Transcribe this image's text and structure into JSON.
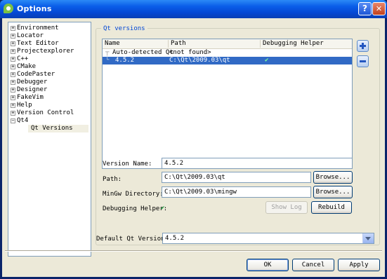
{
  "window": {
    "title": "Options",
    "help_label": "?",
    "close_label": "✕"
  },
  "tree": {
    "items": [
      {
        "label": "Environment",
        "expander": "+"
      },
      {
        "label": "Locator",
        "expander": "+"
      },
      {
        "label": "Text Editor",
        "expander": "+"
      },
      {
        "label": "Projectexplorer",
        "expander": "+"
      },
      {
        "label": "C++",
        "expander": "+"
      },
      {
        "label": "CMake",
        "expander": "+"
      },
      {
        "label": "CodePaster",
        "expander": "+"
      },
      {
        "label": "Debugger",
        "expander": "+"
      },
      {
        "label": "Designer",
        "expander": "+"
      },
      {
        "label": "FakeVim",
        "expander": "+"
      },
      {
        "label": "Help",
        "expander": "+"
      },
      {
        "label": "Version Control",
        "expander": "+"
      },
      {
        "label": "Qt4",
        "expander": "−"
      }
    ],
    "selected_child": "Qt Versions"
  },
  "group": {
    "title": "Qt versions"
  },
  "versions_table": {
    "columns": [
      "Name",
      "Path",
      "Debugging Helper"
    ],
    "rows": [
      {
        "name": "Auto-detected Qt",
        "path": "<not found>",
        "helper": ""
      },
      {
        "name": "4.5.2",
        "path": "C:\\Qt\\2009.03\\qt",
        "helper": "✔"
      }
    ]
  },
  "details": {
    "version_name_label": "Version Name:",
    "version_name_value": "4.5.2",
    "path_label": "Path:",
    "path_value": "C:\\Qt\\2009.03\\qt",
    "mingw_label": "MinGw Directory:",
    "mingw_value": "C:\\Qt\\2009.03\\mingw",
    "browse_label": "Browse...",
    "debugging_helper_label": "Debugging Helper:",
    "debugging_helper_status": "✔",
    "show_log_label": "Show Log",
    "rebuild_label": "Rebuild"
  },
  "default_version": {
    "label": "Default Qt Version:",
    "value": "4.5.2"
  },
  "buttons": {
    "ok": "OK",
    "cancel": "Cancel",
    "apply": "Apply"
  },
  "colors": {
    "selection": "#316AC5",
    "check": "#2EA84A",
    "group_title": "#0046D5"
  }
}
